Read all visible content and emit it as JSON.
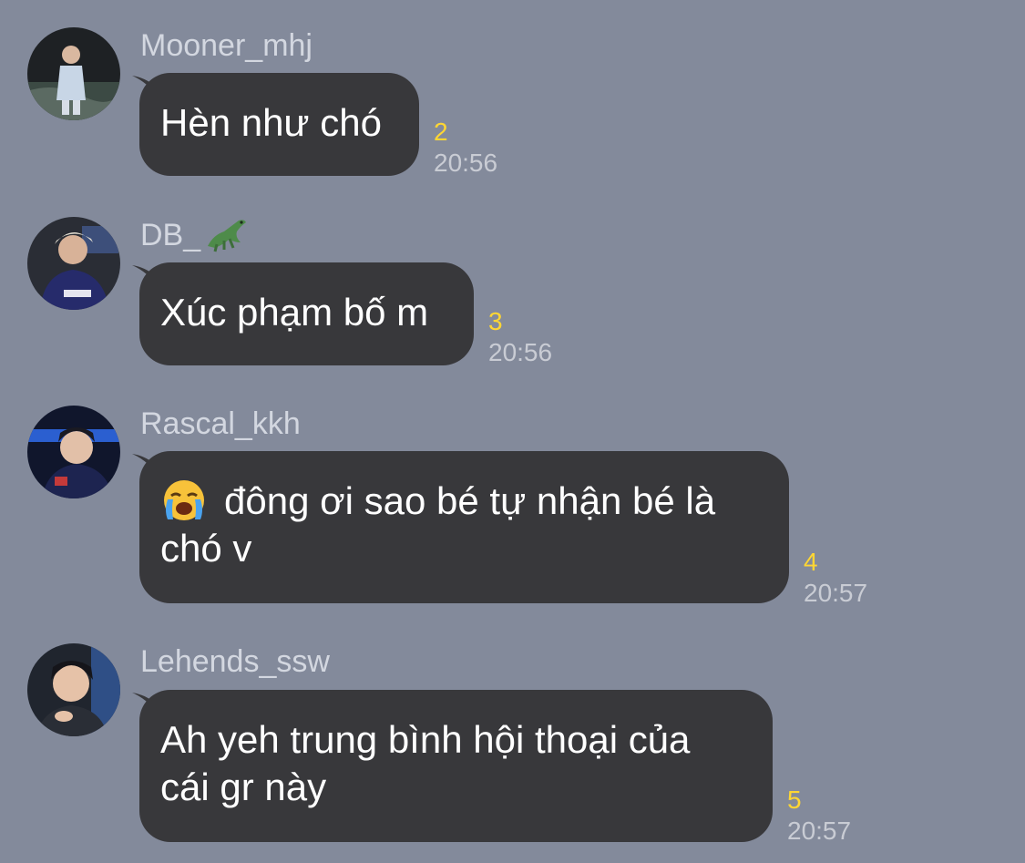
{
  "messages": [
    {
      "sender": "Mooner_mhj",
      "text": "Hèn như chó",
      "read_count": "2",
      "time": "20:56"
    },
    {
      "sender": "DB_",
      "sender_icon": "crocodile-emoji",
      "text": "Xúc phạm bố m",
      "read_count": "3",
      "time": "20:56"
    },
    {
      "sender": "Rascal_kkh",
      "emoji": "loudly-crying-face-emoji",
      "text_line1": "đông ơi sao bé tự nhận bé là",
      "text_line2": "chó v",
      "read_count": "4",
      "time": "20:57"
    },
    {
      "sender": "Lehends_ssw",
      "text_line1": "Ah yeh trung bình hội thoại của",
      "text_line2": "cái gr này",
      "read_count": "5",
      "time": "20:57"
    }
  ],
  "colors": {
    "background": "#838a9b",
    "bubble": "#38383b",
    "read_count": "#ffd633",
    "timestamp": "#c9ccd4",
    "sender_name": "#d3d7e0"
  }
}
